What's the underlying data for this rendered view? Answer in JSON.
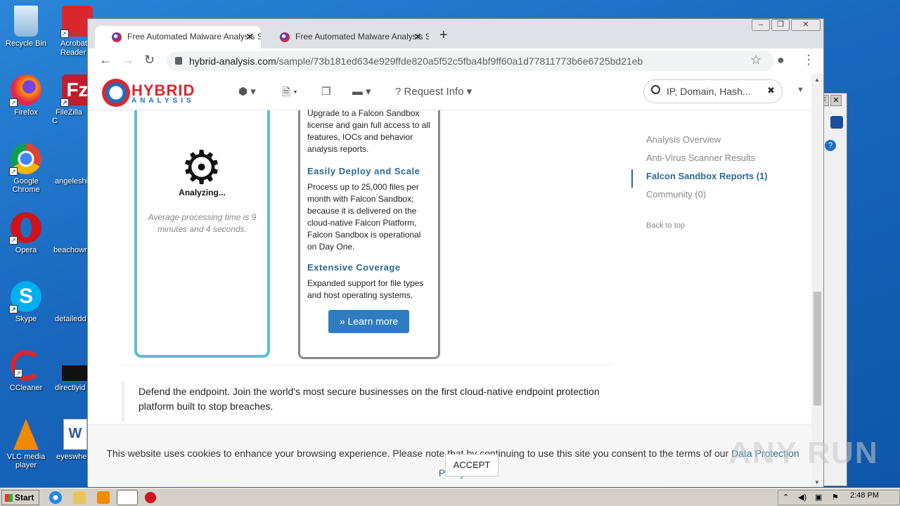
{
  "desktop": {
    "icons": [
      {
        "label": "Recycle Bin",
        "icon": "recycle-bin-icon",
        "color": "#9cc7ea"
      },
      {
        "label": "Acrobat Reader",
        "icon": "acrobat-icon",
        "color": "#d9272e"
      },
      {
        "label": "Firefox",
        "icon": "firefox-icon",
        "color": "#ff7a1a"
      },
      {
        "label": "FileZilla C",
        "icon": "filezilla-icon",
        "color": "#bf1e2d"
      },
      {
        "label": "Google Chrome",
        "icon": "chrome-icon",
        "color": "#34a853"
      },
      {
        "label": "angeleshi",
        "icon": "document-icon",
        "color": "#2f6db3"
      },
      {
        "label": "Opera",
        "icon": "opera-icon",
        "color": "#d0121b"
      },
      {
        "label": "beachown",
        "icon": "document-icon",
        "color": "#2f6db3"
      },
      {
        "label": "Skype",
        "icon": "skype-icon",
        "color": "#00aff0"
      },
      {
        "label": "detailedd",
        "icon": "document-icon",
        "color": "#2f6db3"
      },
      {
        "label": "CCleaner",
        "icon": "ccleaner-icon",
        "color": "#d9272e"
      },
      {
        "label": "directlyid",
        "icon": "video-thumbnail-icon",
        "color": "#111111"
      },
      {
        "label": "VLC media player",
        "icon": "vlc-icon",
        "color": "#f08a00"
      },
      {
        "label": "eyeswhe",
        "icon": "word-document-icon",
        "color": "#2b579a"
      }
    ]
  },
  "browser": {
    "tabs": [
      {
        "title": "Free Automated Malware Analysis S",
        "active": true
      },
      {
        "title": "Free Automated Malware Analysis S",
        "active": false
      }
    ],
    "url_host": "hybrid-analysis.com",
    "url_path": "/sample/73b181ed634e929ffde820a5f52c5fba4bf9ff60a1d77811773b6e6725bd21eb"
  },
  "site": {
    "logo_top": "HYBRID",
    "logo_bottom": "ANALYSIS",
    "nav_request": "Request Info",
    "search_placeholder": "IP, Domain, Hash...",
    "analyzing": "Analyzing...",
    "avg_time": "Average processing time is 9 minutes and 4 seconds.",
    "upgrade_text": "Upgrade to a Falcon Sandbox license and gain full access to all features, IOCs and behavior analysis reports.",
    "deploy_heading": "Easily Deploy and Scale",
    "deploy_text": "Process up to 25,000 files per month with Falcon Sandbox; because it is delivered on the cloud-native Falcon Platform, Falcon Sandbox is operational on Day One.",
    "coverage_heading": "Extensive Coverage",
    "coverage_text": "Expanded support for file types and host operating systems.",
    "learn_more": "Learn more",
    "sidenav": {
      "overview": "Analysis Overview",
      "av": "Anti-Virus Scanner Results",
      "reports": "Falcon Sandbox Reports (1)",
      "community": "Community (0)",
      "back": "Back to top"
    },
    "quote": "Defend the endpoint. Join the world's most secure businesses on the first cloud-native endpoint protection platform built to stop breaches.",
    "cookie_text": "This website uses cookies to enhance your browsing experience. Please note that by continuing to use this site you consent to the terms of our",
    "cookie_link": "Data Protection Policy.",
    "accept": "ACCEPT"
  },
  "watermark": "ANY RUN",
  "taskbar": {
    "start": "Start",
    "clock": "2:48 PM"
  }
}
